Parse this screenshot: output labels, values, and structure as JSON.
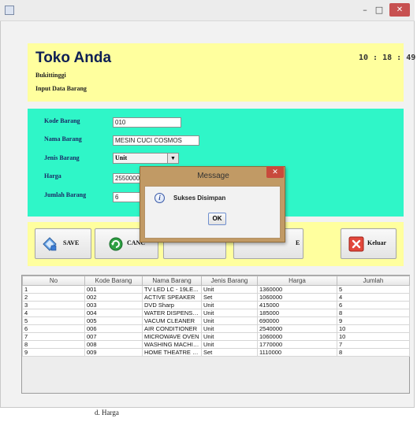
{
  "window": {
    "controls": {
      "minimize": "–",
      "maximize": "□",
      "close": "✕"
    }
  },
  "header": {
    "store_name": "Toko Anda",
    "city": "Bukittinggi",
    "subtitle": "Input Data Barang",
    "clock": "10 : 18 : 49"
  },
  "form": {
    "kode_label": "Kode Barang",
    "kode_value": "010",
    "nama_label": "Nama Barang",
    "nama_value": "MESIN CUCI COSMOS",
    "jenis_label": "Jenis Barang",
    "jenis_value": "Unit",
    "harga_label": "Harga",
    "harga_value": "2550000",
    "jumlah_label": "Jumlah Barang",
    "jumlah_value": "6"
  },
  "buttons": {
    "save": "SAVE",
    "cancel": "CANC",
    "hidden_right": "E",
    "keluar": "Keluar"
  },
  "table": {
    "columns": [
      "No",
      "Kode Barang",
      "Nama Barang",
      "Jenis Barang",
      "Harga",
      "Jumlah"
    ],
    "rows": [
      [
        "1",
        "001",
        "TV LED LC - 19LE...",
        "Unit",
        "1360000",
        "5"
      ],
      [
        "2",
        "002",
        "ACTIVE SPEAKER",
        "Set",
        "1060000",
        "4"
      ],
      [
        "3",
        "003",
        "DVD Sharp",
        "Unit",
        "415000",
        "6"
      ],
      [
        "4",
        "004",
        "WATER DISPENSE...",
        "Unit",
        "185000",
        "8"
      ],
      [
        "5",
        "005",
        "VACUM CLEANER",
        "Unit",
        "690000",
        "9"
      ],
      [
        "6",
        "006",
        "AIR CONDITIONER",
        "Unit",
        "2540000",
        "10"
      ],
      [
        "7",
        "007",
        "MICROWAVE OVEN",
        "Unit",
        "1060000",
        "10"
      ],
      [
        "8",
        "008",
        "WASHING MACHINE",
        "Unit",
        "1770000",
        "7"
      ],
      [
        "9",
        "009",
        "HOME THEATRE S...",
        "Set",
        "1110000",
        "8"
      ]
    ]
  },
  "dialog": {
    "title": "Message",
    "close": "✕",
    "icon_glyph": "i",
    "message": "Sukses Disimpan",
    "ok": "OK"
  },
  "footer": {
    "caption": "d.  Harga"
  },
  "colors": {
    "header_bg": "#ffff9e",
    "form_bg": "#2ff6c8",
    "dialog_frame": "#c19a65",
    "close_red": "#c84a3c"
  },
  "icons": {
    "app": "app-window-icon",
    "save": "diamond-disk-icon",
    "cancel": "green-refresh-icon",
    "keluar": "red-x-icon",
    "info": "info-icon"
  }
}
